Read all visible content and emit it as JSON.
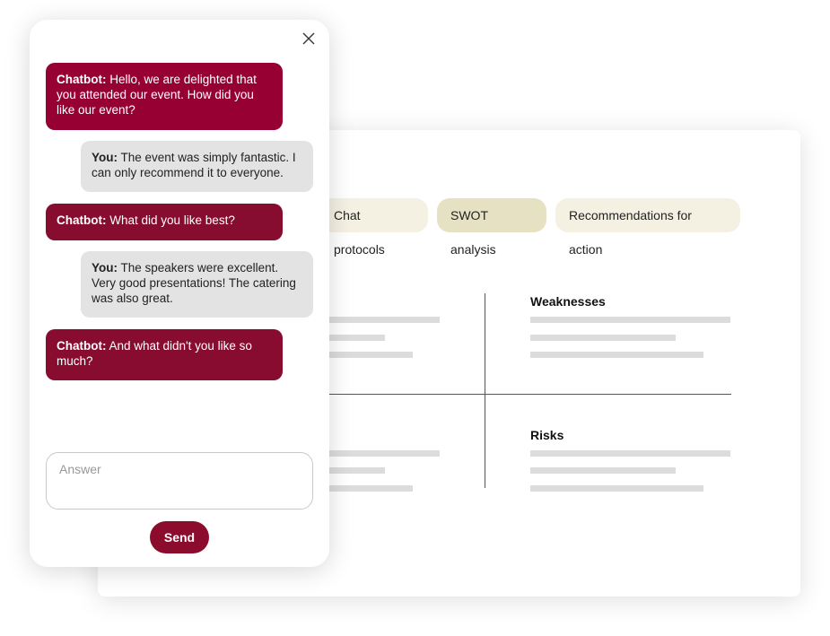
{
  "report": {
    "tabs": [
      {
        "label": "Chat protocols",
        "active": false
      },
      {
        "label": "SWOT analysis",
        "active": true
      },
      {
        "label": "Recommendations for action",
        "active": false
      }
    ],
    "swot": {
      "weaknesses_title": "Weaknesses",
      "risks_title": "Risks"
    }
  },
  "chat": {
    "messages": [
      {
        "sender": "Chatbot:",
        "text": "Hello, we are delighted that you attended our event. How did you like our event?"
      },
      {
        "sender": "You:",
        "text": "The event was simply fantastic. I can only recommend it to everyone."
      },
      {
        "sender": "Chatbot:",
        "text": "What did you like best?"
      },
      {
        "sender": "You:",
        "text": "The speakers were excellent. Very good presentations! The catering was also great."
      },
      {
        "sender": "Chatbot:",
        "text": "And what didn't you like so much?"
      }
    ],
    "answer_placeholder": "Answer",
    "send_label": "Send"
  },
  "icons": {
    "close": "close-icon"
  },
  "colors": {
    "bot_bubble": "#960033",
    "user_bubble": "#e3e3e3",
    "send_button": "#8c0c2e",
    "tab_active": "#e6e1c3",
    "tab_inactive": "#f4f1e3"
  }
}
